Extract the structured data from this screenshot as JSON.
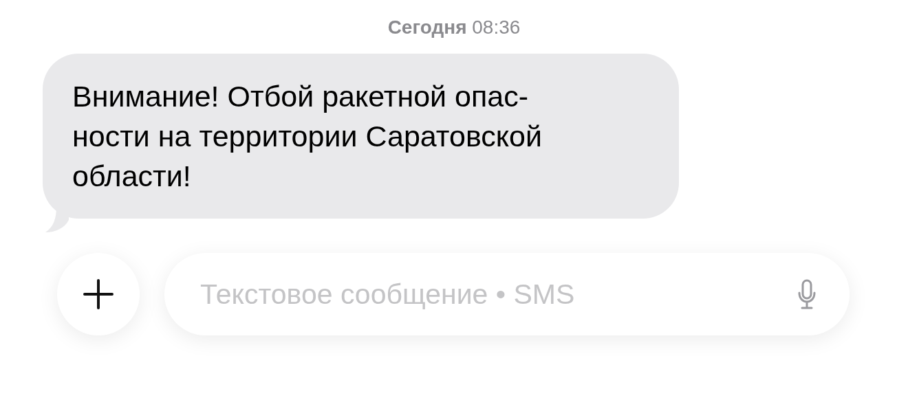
{
  "timestamp": "**Сегодня** 08:36",
  "messages": [
    {
      "text": "Внимание! Отбой ракетной опас-\nности на территории Саратовской\nобласти!",
      "incoming": true
    }
  ],
  "composer": {
    "placeholder": "Текстовое сообщение • SMS"
  }
}
